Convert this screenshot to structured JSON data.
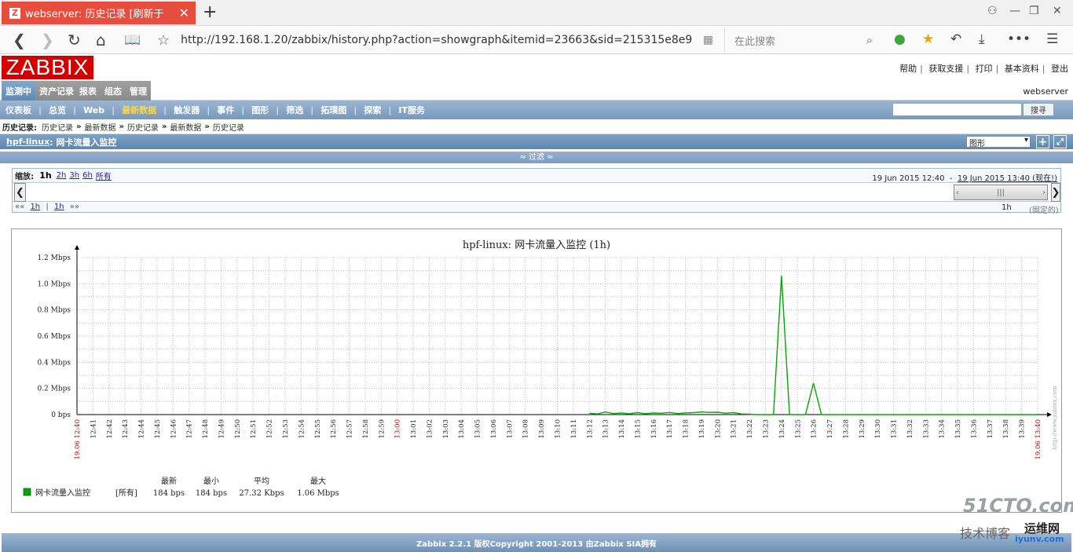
{
  "browser": {
    "tab_title": "webserver: 历史记录 [刷新于",
    "favicon": "Z",
    "url": "http://192.168.1.20/zabbix/history.php?action=showgraph&itemid=23663&sid=215315e8e9",
    "search_placeholder": "在此搜索"
  },
  "zabbix": {
    "logo": "ZABBIX",
    "top_links": [
      "帮助",
      "获取支援",
      "打印",
      "基本资料",
      "登出"
    ],
    "main_tabs": [
      "监测中",
      "资产记录",
      "报表",
      "组态",
      "管理"
    ],
    "host_label": "webserver",
    "sub_menu": [
      "仪表板",
      "总览",
      "Web",
      "最新数据",
      "触发器",
      "事件",
      "图形",
      "筛选",
      "拓璞图",
      "探索",
      "IT服务"
    ],
    "search_button": "搜寻",
    "history_label": "历史记录:",
    "history_links": [
      "历史记录",
      "最新数据",
      "历史记录",
      "最新数据",
      "历史记录"
    ],
    "page_host": "hpf-linux",
    "page_item": ": 网卡流量入监控",
    "view_select": "图形",
    "filter_label": "≈ 过滤 ≈"
  },
  "scroll": {
    "zoom_label": "缩放:",
    "zoom_current": "1h",
    "zoom_links": [
      "2h",
      "3h",
      "6h",
      "所有"
    ],
    "period_from": "19 Jun 2015 12:40",
    "period_sep": "-",
    "period_to": "19 Jun 2015 13:40 (现在!)",
    "nav_prev": "««",
    "nav_1h_a": "1h",
    "nav_sep": "|",
    "nav_1h_b": "1h",
    "nav_next": "»»",
    "fixed_period": "1h",
    "fixed_label": "(固定的)"
  },
  "chart_data": {
    "type": "line",
    "title": "hpf-linux: 网卡流量入监控 (1h)",
    "y_tick_labels": [
      "0 bps",
      "0.2 Mbps",
      "0.4 Mbps",
      "0.6 Mbps",
      "0.8 Mbps",
      "1.0 Mbps",
      "1.2 Mbps"
    ],
    "ylim": [
      0,
      1.2
    ],
    "y_unit": "Mbps",
    "x_start_label": "19.06 12:40",
    "x_end_label": "19.06 13:40",
    "x_tick_labels": [
      "12:41",
      "12:42",
      "12:43",
      "12:44",
      "12:45",
      "12:46",
      "12:47",
      "12:48",
      "12:49",
      "12:50",
      "12:51",
      "12:52",
      "12:53",
      "12:54",
      "12:55",
      "12:56",
      "12:57",
      "12:58",
      "12:59",
      "13:00",
      "13:01",
      "13:02",
      "13:03",
      "13:04",
      "13:05",
      "13:06",
      "13:07",
      "13:08",
      "13:09",
      "13:10",
      "13:11",
      "13:12",
      "13:13",
      "13:14",
      "13:15",
      "13:16",
      "13:17",
      "13:18",
      "13:19",
      "13:20",
      "13:21",
      "13:22",
      "13:23",
      "13:24",
      "13:25",
      "13:26",
      "13:27",
      "13:28",
      "13:29",
      "13:30",
      "13:31",
      "13:32",
      "13:33",
      "13:34",
      "13:35",
      "13:36",
      "13:37",
      "13:38",
      "13:39"
    ],
    "grid": true,
    "series": [
      {
        "name": "网卡流量入监控",
        "color": "#00aa00",
        "x_minutes": [
          32.0,
          32.5,
          33.0,
          33.5,
          34.0,
          34.5,
          35.0,
          35.5,
          36.0,
          36.5,
          37.0,
          37.5,
          38.0,
          38.5,
          39.0,
          39.5,
          40.0,
          40.5,
          41.0,
          41.5,
          42.0,
          42.5,
          43.0,
          43.5,
          44.0,
          44.5,
          45.0,
          45.5,
          46.0,
          46.5,
          47.0,
          48.0,
          50.0,
          52.0,
          54.0,
          56.0,
          58.0,
          60.0
        ],
        "values": [
          0.01,
          0.005,
          0.02,
          0.008,
          0.012,
          0.006,
          0.015,
          0.007,
          0.012,
          0.01,
          0.016,
          0.008,
          0.012,
          0.015,
          0.02,
          0.017,
          0.018,
          0.01,
          0.015,
          0.005,
          0.003,
          0.0,
          0.0,
          0.0,
          1.06,
          0.0,
          0.0,
          0.0,
          0.24,
          0.0,
          0.0,
          0.0,
          0.0,
          0.0,
          0.0,
          0.0,
          0.0,
          0.0
        ]
      }
    ],
    "legend": {
      "headers": [
        "最新",
        "最小",
        "平均",
        "最大"
      ],
      "name": "网卡流量入监控",
      "func": "[所有]",
      "last": "184 bps",
      "min": "184 bps",
      "avg": "27.32 Kbps",
      "max": "1.06 Mbps"
    },
    "watermark": "http://www.zabbix.com"
  },
  "footer": "Zabbix 2.2.1 版权Copyright 2001-2013 由Zabbix SIA拥有",
  "site_watermark": {
    "line1": "51CTO.com",
    "line2": "技术博客",
    "line3": "运维网",
    "line4": "iyunv.com"
  }
}
